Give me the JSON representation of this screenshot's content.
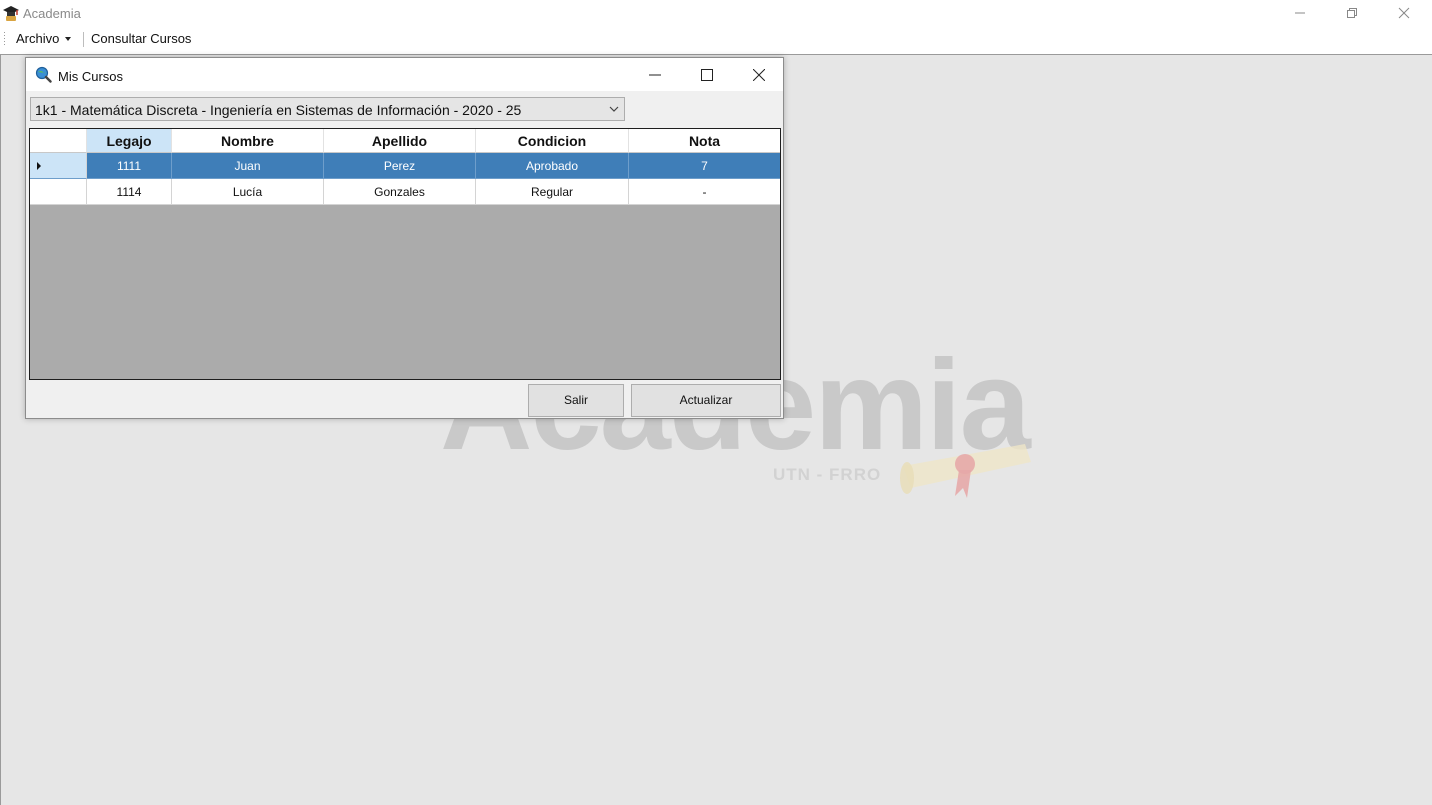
{
  "app": {
    "title": "Academia"
  },
  "menubar": {
    "archivo_label": "Archivo",
    "consultar_label": "Consultar Cursos"
  },
  "watermark": {
    "logo_text": "Academia",
    "subtitle": "UTN - FRRO"
  },
  "child_window": {
    "title": "Mis Cursos",
    "course_select": {
      "value": "1k1 - Matemática Discreta - Ingeniería en Sistemas de Información - 2020 - 25"
    },
    "grid": {
      "columns": [
        "Legajo",
        "Nombre",
        "Apellido",
        "Condicion",
        "Nota"
      ],
      "rows": [
        [
          "1111",
          "Juan",
          "Perez",
          "Aprobado",
          "7"
        ],
        [
          "1114",
          "Lucía",
          "Gonzales",
          "Regular",
          "-"
        ]
      ]
    },
    "buttons": {
      "salir_label": "Salir",
      "actualizar_label": "Actualizar"
    }
  },
  "colors": {
    "selection": "#3f7eb8",
    "header_active": "#cce4f7",
    "mdi_background": "#e6e6e6"
  }
}
